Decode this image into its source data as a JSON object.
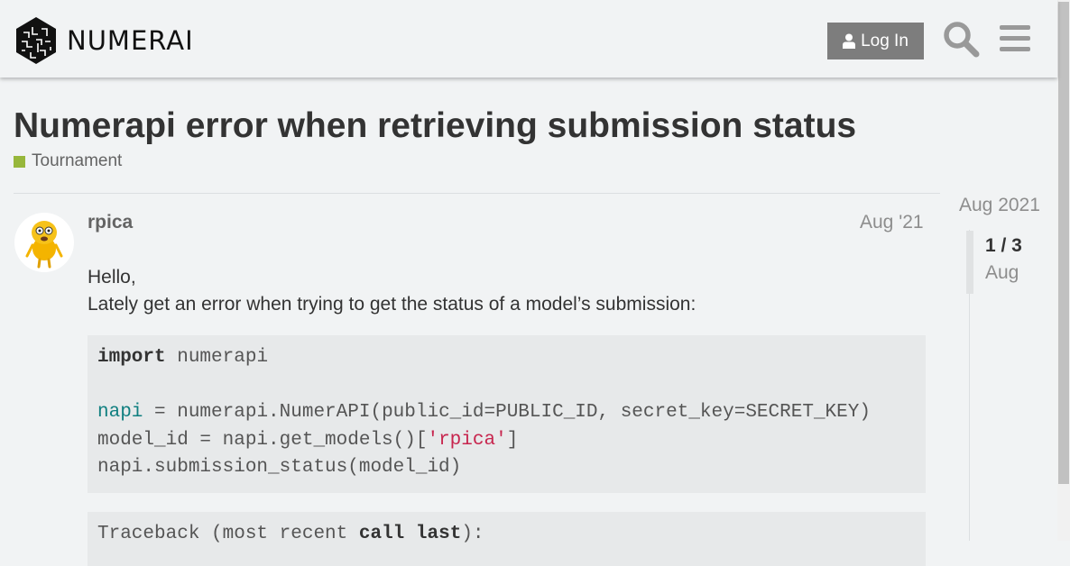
{
  "header": {
    "brand": "NUMERAI",
    "login_label": "Log In",
    "search_icon": "search-icon",
    "menu_icon": "hamburger-menu-icon"
  },
  "topic": {
    "title": "Numerapi error when retrieving submission status",
    "category": "Tournament",
    "category_color": "#97b73b"
  },
  "post": {
    "username": "rpica",
    "date": "Aug '21",
    "line1": "Hello,",
    "line2": "Lately get an error when trying to get the status of a model’s submission:",
    "code": {
      "l1_kw": "import",
      "l1_rest": " numerapi",
      "l3_var": "napi",
      "l3_rest": " = numerapi.NumerAPI(public_id=PUBLIC_ID, secret_key=SECRET_KEY)",
      "l4_pre": "model_id = napi.get_models()[",
      "l4_str": "'rpica'",
      "l4_post": "]",
      "l5": "napi.submission_status(model_id)"
    },
    "code2": {
      "pre": "Traceback (most recent ",
      "kw1": "call",
      "mid": " ",
      "kw2": "last",
      "post": "):"
    }
  },
  "timeline": {
    "start_label": "Aug 2021",
    "position": "1 / 3",
    "current_date": "Aug"
  },
  "colors": {
    "accent": "#7d7d7d",
    "background": "#f1f3f4"
  }
}
